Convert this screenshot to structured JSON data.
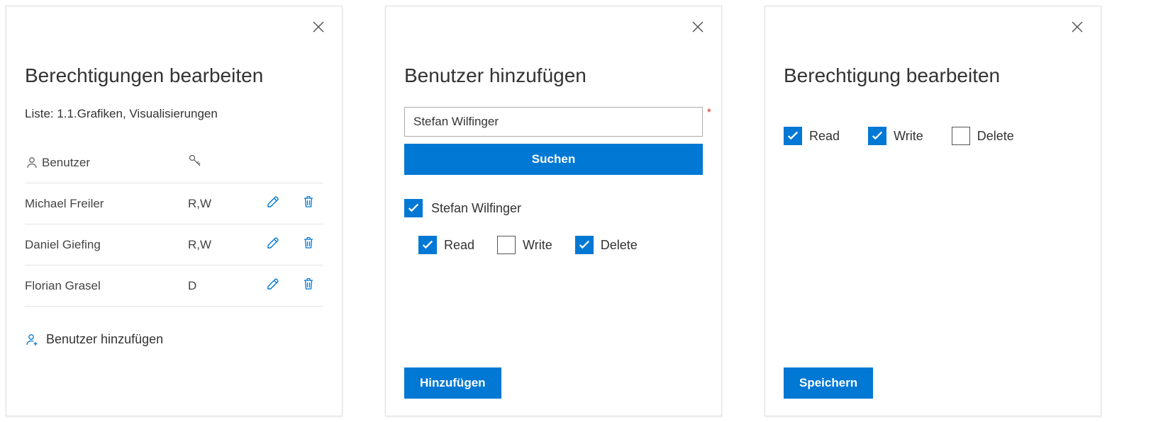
{
  "panel1": {
    "title": "Berechtigungen bearbeiten",
    "subtitle": "Liste: 1.1.Grafiken, Visualisierungen",
    "header_user": "Benutzer",
    "rows": [
      {
        "name": "Michael Freiler",
        "perm": "R,W"
      },
      {
        "name": "Daniel Giefing",
        "perm": "R,W"
      },
      {
        "name": "Florian Grasel",
        "perm": "D"
      }
    ],
    "add_user_label": "Benutzer hinzufügen"
  },
  "panel2": {
    "title": "Benutzer hinzufügen",
    "input_value": "Stefan Wilfinger",
    "search_label": "Suchen",
    "result_name": "Stefan Wilfinger",
    "perm_read": "Read",
    "perm_write": "Write",
    "perm_delete": "Delete",
    "add_label": "Hinzufügen"
  },
  "panel3": {
    "title": "Berechtigung bearbeiten",
    "perm_read": "Read",
    "perm_write": "Write",
    "perm_delete": "Delete",
    "save_label": "Speichern"
  }
}
